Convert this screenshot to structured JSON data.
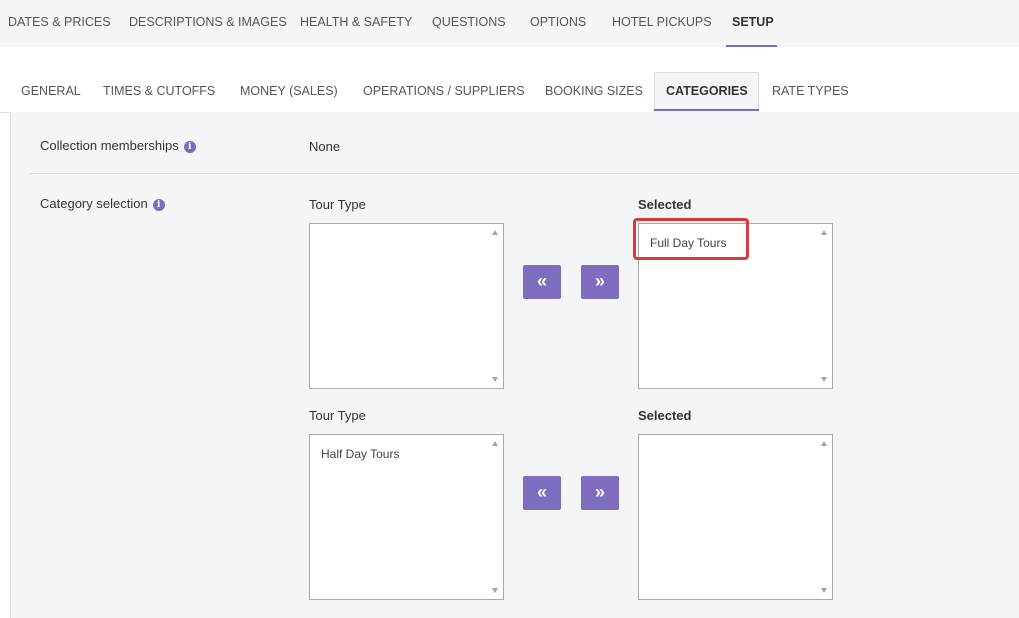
{
  "top_tabs": [
    {
      "label": "DATES & PRICES"
    },
    {
      "label": "DESCRIPTIONS & IMAGES"
    },
    {
      "label": "HEALTH & SAFETY"
    },
    {
      "label": "QUESTIONS"
    },
    {
      "label": "OPTIONS"
    },
    {
      "label": "HOTEL PICKUPS"
    },
    {
      "label": "SETUP"
    }
  ],
  "top_active": "SETUP",
  "sub_tabs": [
    {
      "label": "GENERAL"
    },
    {
      "label": "TIMES & CUTOFFS"
    },
    {
      "label": "MONEY (SALES)"
    },
    {
      "label": "OPERATIONS / SUPPLIERS"
    },
    {
      "label": "BOOKING SIZES"
    },
    {
      "label": "CATEGORIES"
    },
    {
      "label": "RATE TYPES"
    }
  ],
  "sub_active": "CATEGORIES",
  "collection": {
    "label": "Collection memberships",
    "value": "None"
  },
  "category": {
    "label": "Category selection",
    "groups": [
      {
        "available_label": "Tour Type",
        "available_items": [],
        "selected_label": "Selected",
        "selected_items": [
          "Full Day Tours"
        ]
      },
      {
        "available_label": "Tour Type",
        "available_items": [
          "Half Day Tours"
        ],
        "selected_label": "Selected",
        "selected_items": []
      }
    ]
  },
  "buttons": {
    "move_left": "«",
    "move_right": "»"
  },
  "info_glyph": "i",
  "colors": {
    "accent": "#7e6dbf",
    "highlight": "#d93b3b",
    "panel_bg": "#f4f5f7"
  }
}
